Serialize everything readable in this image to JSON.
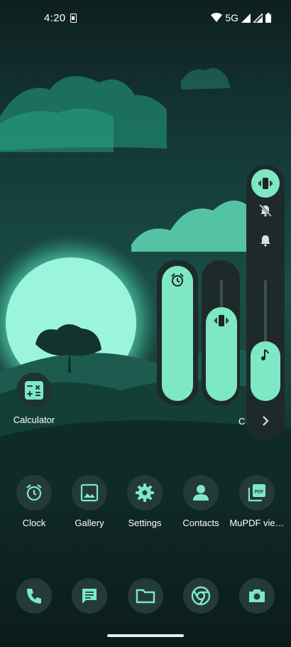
{
  "status_bar": {
    "time": "4:20",
    "network": "5G"
  },
  "home": {
    "calculator_label": "Calculator",
    "partial_label": "C"
  },
  "apps_row": [
    {
      "label": "Clock",
      "icon": "alarm-clock-icon"
    },
    {
      "label": "Gallery",
      "icon": "image-icon"
    },
    {
      "label": "Settings",
      "icon": "gear-icon"
    },
    {
      "label": "Contacts",
      "icon": "person-icon"
    },
    {
      "label": "MuPDF vie…",
      "icon": "pdf-icon"
    }
  ],
  "dock": [
    {
      "icon": "phone-icon"
    },
    {
      "icon": "message-icon"
    },
    {
      "icon": "folder-icon"
    },
    {
      "icon": "chrome-icon"
    },
    {
      "icon": "camera-icon"
    }
  ],
  "volume_panel": {
    "alarm_level": 1.0,
    "ring_level": 0.73,
    "media_level": 0.45,
    "ringer_mode": "vibrate"
  },
  "colors": {
    "accent": "#7ee8c5",
    "icon_bg": "#243a38",
    "panel_bg": "#1e2a29"
  }
}
